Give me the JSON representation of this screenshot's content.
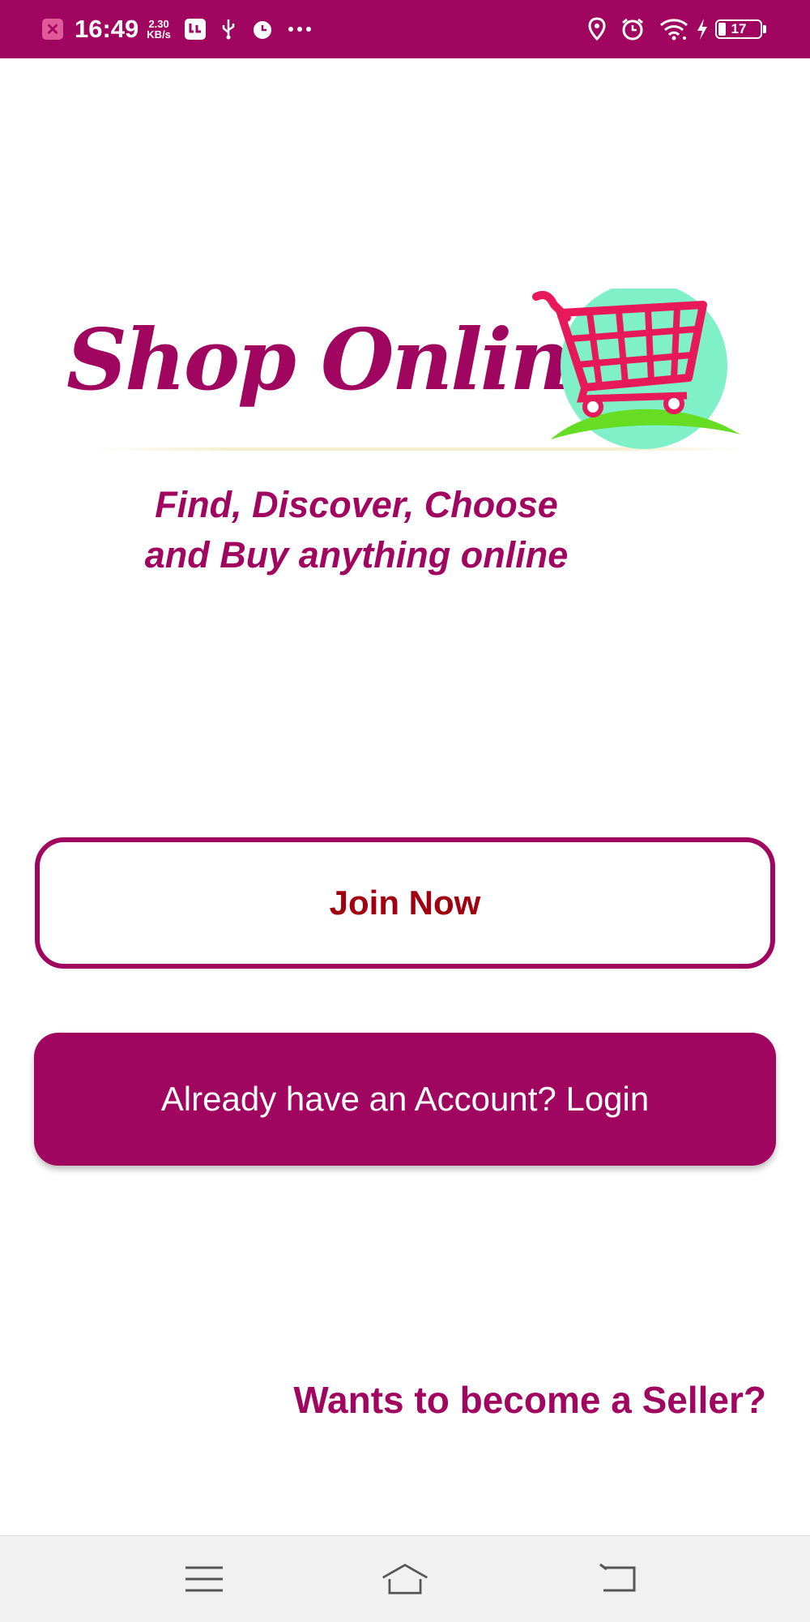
{
  "status_bar": {
    "time": "16:49",
    "speed_value": "2.30",
    "speed_unit": "KB/s",
    "battery_level": "17",
    "left_icons": [
      "close-notification-icon",
      "data-saver-icon",
      "usb-icon",
      "alarm-icon",
      "more-dots-icon"
    ],
    "right_icons": [
      "location-icon",
      "alarm-icon",
      "wifi-icon",
      "charging-bolt-icon",
      "battery-icon"
    ]
  },
  "logo": {
    "text": "Shop Online",
    "icon": "shopping-cart-icon"
  },
  "tagline": {
    "line1": "Find, Discover, Choose",
    "line2": "and Buy anything online"
  },
  "actions": {
    "join_label": "Join Now",
    "login_label": "Already have an Account? Login",
    "seller_label": "Wants to become a Seller?"
  },
  "nav_bar": {
    "icons": [
      "menu-icon",
      "home-icon",
      "back-icon"
    ]
  },
  "colors": {
    "brand": "#a0055f",
    "join_text": "#a00010",
    "cart_red": "#e8195a",
    "cart_bg": "#7ff0c8",
    "cart_green": "#66dd22"
  }
}
